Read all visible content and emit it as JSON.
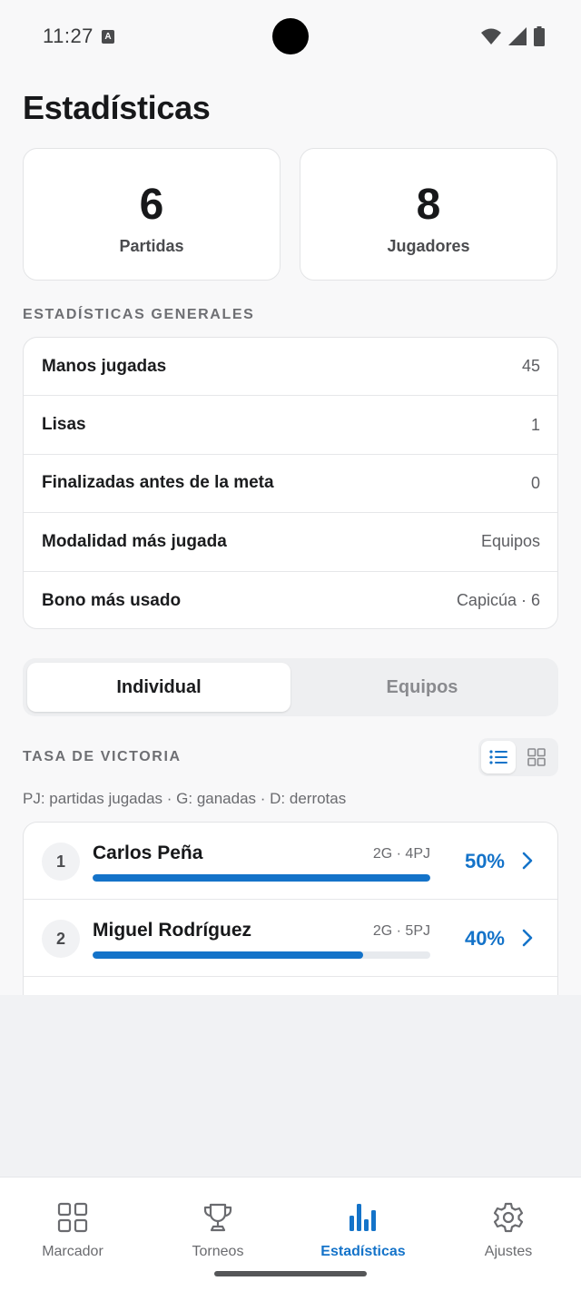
{
  "status_bar": {
    "time": "11:27",
    "notification_badge": "A"
  },
  "header": {
    "title": "Estadísticas"
  },
  "summary": [
    {
      "value": "6",
      "label": "Partidas"
    },
    {
      "value": "8",
      "label": "Jugadores"
    }
  ],
  "general": {
    "section_label": "ESTADÍSTICAS GENERALES",
    "rows": [
      {
        "label": "Manos jugadas",
        "value": "45"
      },
      {
        "label": "Lisas",
        "value": "1"
      },
      {
        "label": "Finalizadas antes de la meta",
        "value": "0"
      },
      {
        "label": "Modalidad más jugada",
        "value": "Equipos"
      },
      {
        "label": "Bono más usado",
        "value": "Capicúa · 6"
      }
    ]
  },
  "mode_tabs": {
    "individual": "Individual",
    "teams": "Equipos",
    "selected": "Individual"
  },
  "win_rate": {
    "section_label": "TASA DE VICTORIA",
    "legend": "PJ: partidas jugadas · G: ganadas · D: derrotas",
    "view": "list",
    "players": [
      {
        "rank": "1",
        "name": "Carlos Peña",
        "record": "2G · 4PJ",
        "percent_label": "50%",
        "rate": 0.5
      },
      {
        "rank": "2",
        "name": "Miguel Rodríguez",
        "record": "2G · 5PJ",
        "percent_label": "40%",
        "rate": 0.4
      }
    ]
  },
  "nav": {
    "items": [
      {
        "label": "Marcador",
        "icon": "grid-icon"
      },
      {
        "label": "Torneos",
        "icon": "trophy-icon"
      },
      {
        "label": "Estadísticas",
        "icon": "bar-chart-icon"
      },
      {
        "label": "Ajustes",
        "icon": "gear-icon"
      }
    ],
    "active": "Estadísticas"
  },
  "colors": {
    "accent": "#1473c9",
    "background": "#f8f8f9"
  }
}
